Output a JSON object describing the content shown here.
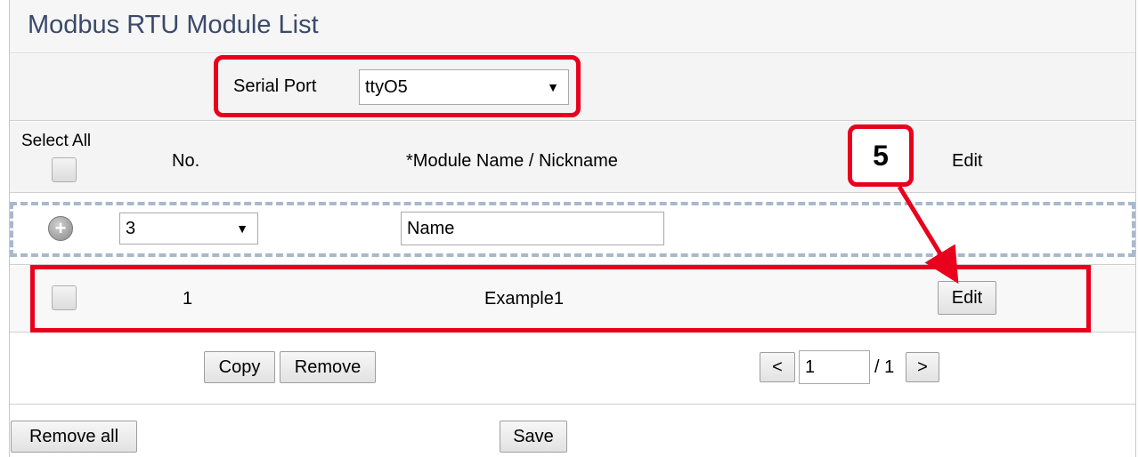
{
  "page": {
    "title": "Modbus RTU Module List"
  },
  "serial_port": {
    "label": "Serial Port",
    "value": "ttyO5"
  },
  "table_header": {
    "select_all": "Select All",
    "no": "No.",
    "module_name": "*Module Name / Nickname",
    "edit": "Edit"
  },
  "new_row": {
    "count_value": "3",
    "name_value": "Name"
  },
  "rows": [
    {
      "no": "1",
      "name": "Example1",
      "edit_label": "Edit"
    }
  ],
  "actions": {
    "copy": "Copy",
    "remove": "Remove"
  },
  "pager": {
    "prev": "<",
    "page": "1",
    "total": "/ 1",
    "next": ">"
  },
  "footer": {
    "remove_all": "Remove all",
    "save": "Save"
  },
  "annotation": {
    "step": "5",
    "color": "#e8001c"
  }
}
